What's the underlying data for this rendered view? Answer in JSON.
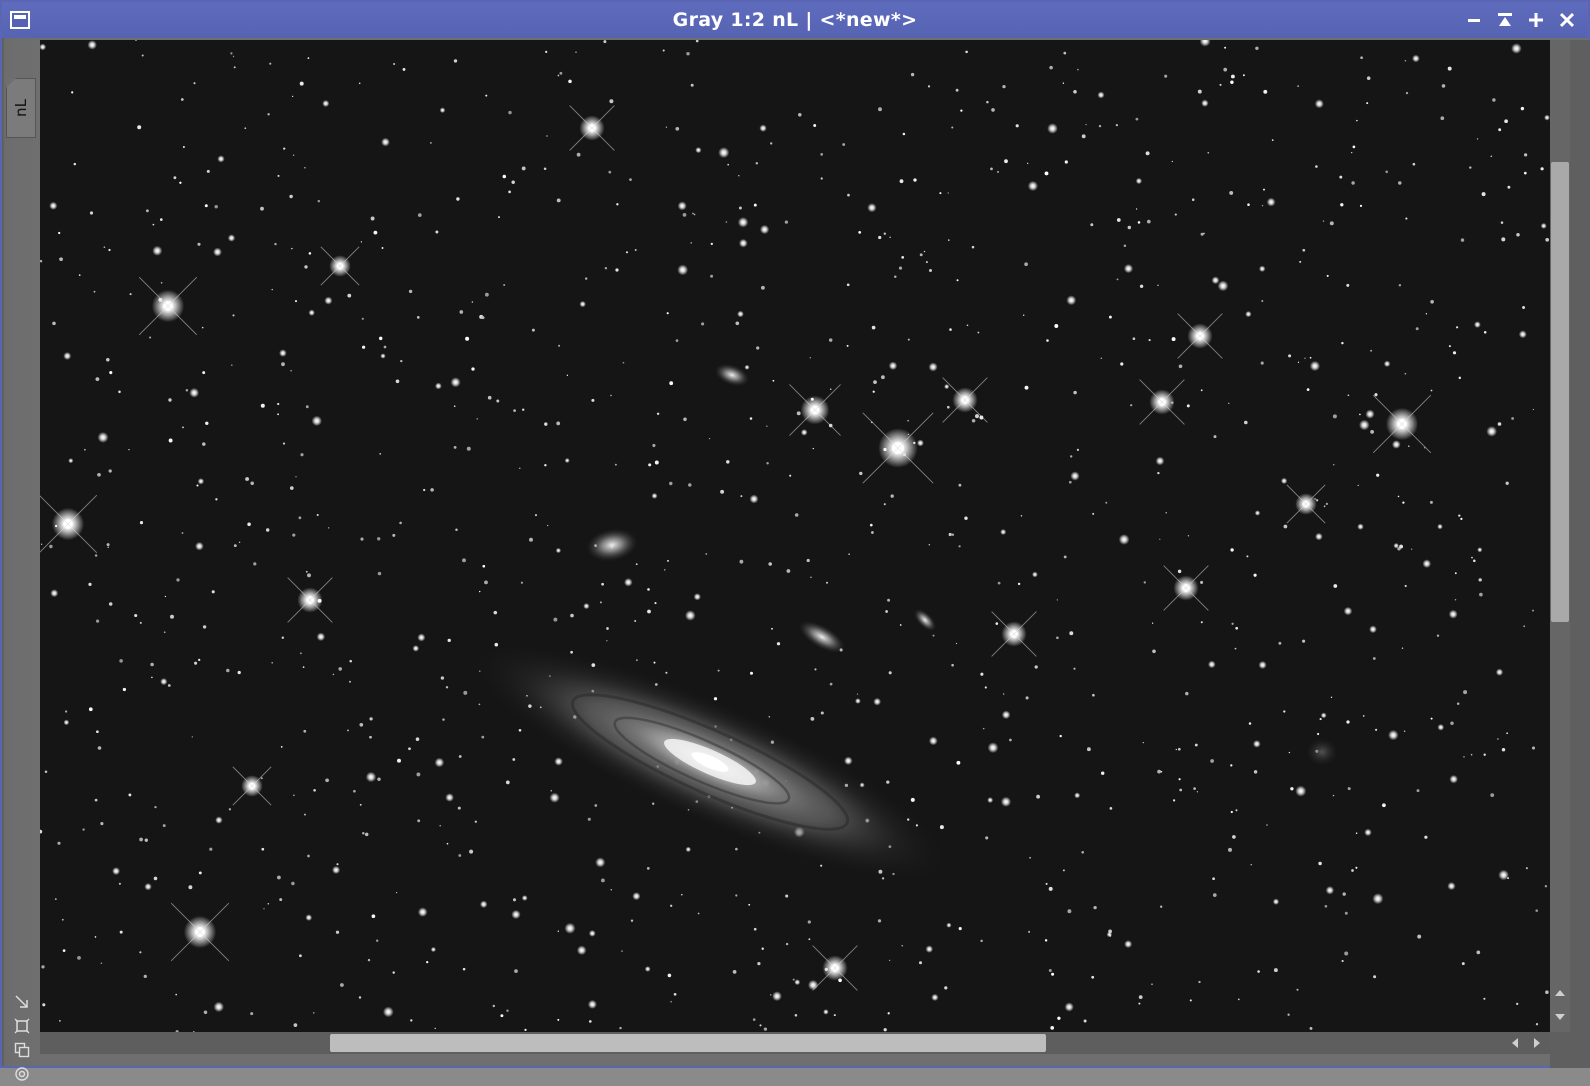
{
  "window": {
    "title": "Gray 1:2 nL | <*new*>",
    "controls": [
      "minimize-icon",
      "shade-icon",
      "maximize-icon",
      "close-icon"
    ]
  },
  "sidebar": {
    "view_tab_label": "nL",
    "tools": [
      "resize-to-fit-icon",
      "fit-view-icon",
      "clone-view-icon",
      "view-mode-icon"
    ]
  },
  "image": {
    "description_icon": "astronomical-image",
    "colors": {
      "background": "#141414",
      "titlebar": "#5663b3"
    }
  }
}
